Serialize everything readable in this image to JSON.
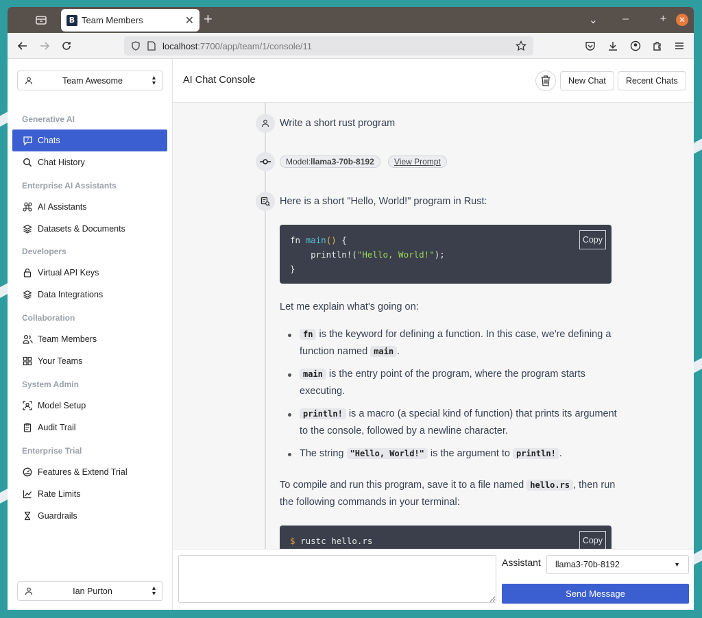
{
  "browser": {
    "tab_title": "Team Members",
    "tab_favicon_letter": "B",
    "url_host": "localhost",
    "url_path": ":7700/app/team/1/console/11"
  },
  "sidebar": {
    "team_selector": "Team Awesome",
    "sections": [
      {
        "title": "Generative AI",
        "items": [
          {
            "label": "Chats",
            "icon": "chat-question-icon",
            "active": true
          },
          {
            "label": "Chat History",
            "icon": "search-icon"
          }
        ]
      },
      {
        "title": "Enterprise AI Assistants",
        "items": [
          {
            "label": "AI Assistants",
            "icon": "command-icon"
          },
          {
            "label": "Datasets & Documents",
            "icon": "stack-icon"
          }
        ]
      },
      {
        "title": "Developers",
        "items": [
          {
            "label": "Virtual API Keys",
            "icon": "lock-icon"
          },
          {
            "label": "Data Integrations",
            "icon": "stack-icon"
          }
        ]
      },
      {
        "title": "Collaboration",
        "items": [
          {
            "label": "Team Members",
            "icon": "users-icon"
          },
          {
            "label": "Your Teams",
            "icon": "grid-icon"
          }
        ]
      },
      {
        "title": "System Admin",
        "items": [
          {
            "label": "Model Setup",
            "icon": "focus-user-icon"
          },
          {
            "label": "Audit Trail",
            "icon": "clipboard-icon"
          }
        ]
      },
      {
        "title": "Enterprise Trial",
        "items": [
          {
            "label": "Features & Extend Trial",
            "icon": "gauge-icon"
          },
          {
            "label": "Rate Limits",
            "icon": "chart-icon"
          },
          {
            "label": "Guardrails",
            "icon": "hourglass-icon"
          }
        ]
      }
    ],
    "user_selector": "Ian Purton"
  },
  "header": {
    "title": "AI Chat Console",
    "new_chat": "New Chat",
    "recent_chats": "Recent Chats"
  },
  "chat": {
    "user_message": "Write a short rust program",
    "model_label": "Model:",
    "model_name": "llama3-70b-8192",
    "view_prompt": "View Prompt",
    "intro": "Here is a short \"Hello, World!\" program in Rust:",
    "code1": {
      "line1_kw": "fn ",
      "line1_name": "main",
      "line1_parens": "()",
      "line1_brace": " {",
      "line2_pre": "    println!(",
      "line2_str": "\"Hello, World!\"",
      "line2_post": ");",
      "line3": "}"
    },
    "copy_label": "Copy",
    "explain_intro": "Let me explain what's going on:",
    "bullets": [
      {
        "code": "fn",
        "text": " is the keyword for defining a function. In this case, we're defining a function named ",
        "code2": "main",
        "tail": "."
      },
      {
        "code": "main",
        "text": " is the entry point of the program, where the program starts executing."
      },
      {
        "code": "println!",
        "text": " is a macro (a special kind of function) that prints its argument to the console, followed by a newline character."
      },
      {
        "pre": "The string ",
        "code": "\"Hello, World!\"",
        "text": " is the argument to ",
        "code2": "println!",
        "tail": "."
      }
    ],
    "compile_pre": "To compile and run this program, save it to a file named ",
    "compile_code": "hello.rs",
    "compile_post": ", then run the following commands in your terminal:",
    "code2": {
      "prompt": "$ ",
      "cmd": "rustc hello.rs"
    }
  },
  "composer": {
    "assistant_label": "Assistant",
    "assistant_value": "llama3-70b-8192",
    "send": "Send Message"
  }
}
